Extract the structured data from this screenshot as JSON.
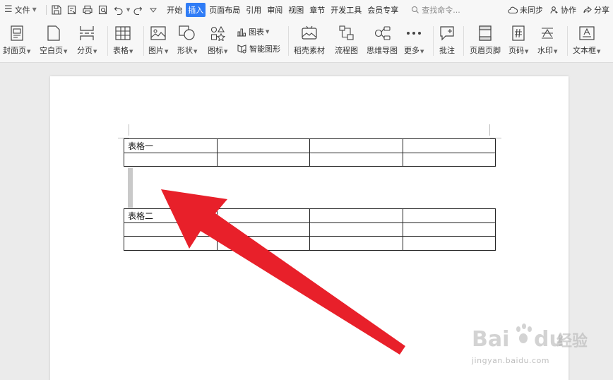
{
  "menubar": {
    "file_label": "文件",
    "tabs": [
      {
        "label": "开始",
        "active": false
      },
      {
        "label": "插入",
        "active": true
      },
      {
        "label": "页面布局",
        "active": false
      },
      {
        "label": "引用",
        "active": false
      },
      {
        "label": "审阅",
        "active": false
      },
      {
        "label": "视图",
        "active": false
      },
      {
        "label": "章节",
        "active": false
      },
      {
        "label": "开发工具",
        "active": false
      },
      {
        "label": "会员专享",
        "active": false
      }
    ],
    "search_placeholder": "查找命令...",
    "right": {
      "sync": "未同步",
      "collab": "协作",
      "share": "分享"
    }
  },
  "ribbon": {
    "cover": "封面页",
    "blank": "空白页",
    "pagebreak": "分页",
    "table": "表格",
    "picture": "图片",
    "shape": "形状",
    "icon": "图标",
    "chart": "图表",
    "smartart": "智能图形",
    "material": "稻壳素材",
    "flowchart": "流程图",
    "mindmap": "思维导图",
    "more": "更多",
    "comment": "批注",
    "headerfooter": "页眉页脚",
    "pagenum": "页码",
    "watermark": "水印",
    "textbox": "文本框"
  },
  "document": {
    "table1": {
      "rows": [
        [
          "表格一",
          "",
          "",
          ""
        ],
        [
          "",
          "",
          "",
          ""
        ]
      ]
    },
    "table2": {
      "rows": [
        [
          "表格二",
          "",
          "",
          ""
        ],
        [
          "",
          "",
          "",
          ""
        ],
        [
          "",
          "",
          "",
          ""
        ]
      ]
    }
  },
  "watermark": {
    "brand": "Bai",
    "brand2": "du",
    "jingyan": "经验",
    "url": "jingyan.baidu.com"
  },
  "colors": {
    "accent": "#2f7cf6",
    "arrow": "#e8202a"
  }
}
